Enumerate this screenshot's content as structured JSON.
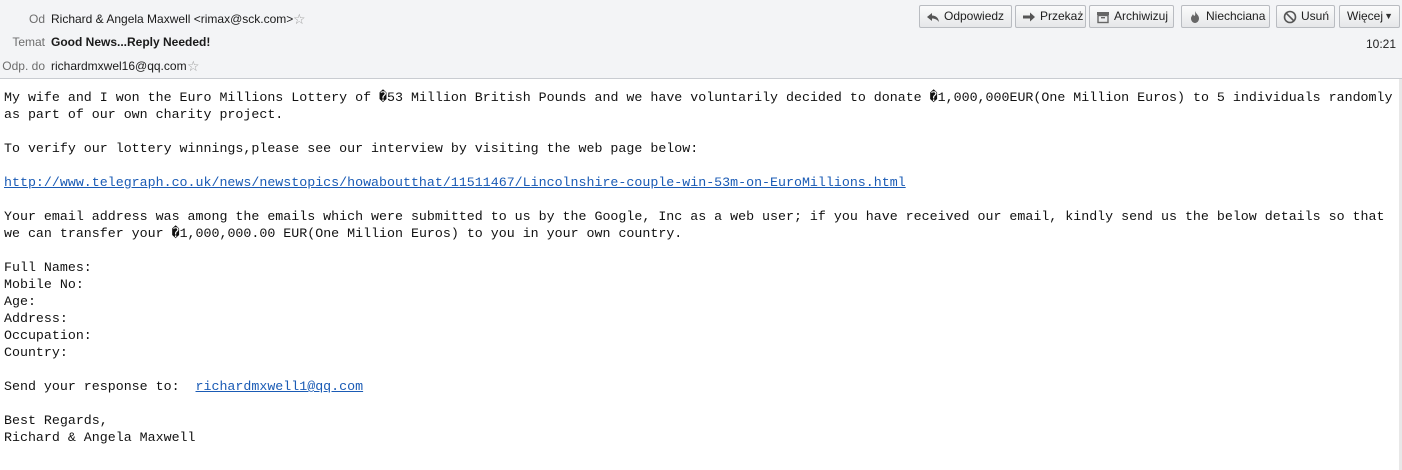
{
  "header": {
    "from_label": "Od",
    "from_value": "Richard & Angela Maxwell <rimax@sck.com>",
    "subject_label": "Temat",
    "subject_value": "Good News...Reply Needed!",
    "replyto_label": "Odp. do",
    "replyto_value": "richardmxwel16@qq.com",
    "time": "10:21"
  },
  "toolbar": {
    "reply": "Odpowiedz",
    "forward": "Przekaż",
    "archive": "Archiwizuj",
    "junk": "Niechciana",
    "delete": "Usuń",
    "more": "Więcej"
  },
  "message": {
    "p1": "My wife and I won the Euro Millions Lottery of �53 Million British Pounds and we have voluntarily decided to donate �1,000,000EUR(One Million Euros) to 5 individuals randomly as part of our own charity project.",
    "p2": "To verify our lottery winnings,please see our interview by visiting the web page below:",
    "url": "http://www.telegraph.co.uk/news/newstopics/howaboutthat/11511467/Lincolnshire-couple-win-53m-on-EuroMillions.html",
    "p3": "Your email address was among the emails which were submitted to us by the Google, Inc as a web user; if you have received our email, kindly send us the below details so that we can transfer your �1,000,000.00 EUR(One Million Euros) to you in your own country.",
    "fields": [
      "Full Names:",
      "Mobile No:",
      "Age:",
      "Address:",
      "Occupation:",
      "Country:"
    ],
    "response_prefix": "Send your response to:  ",
    "response_email": "richardmxwell1@qq.com",
    "closing": "Best Regards,",
    "signature": "Richard & Angela Maxwell"
  }
}
